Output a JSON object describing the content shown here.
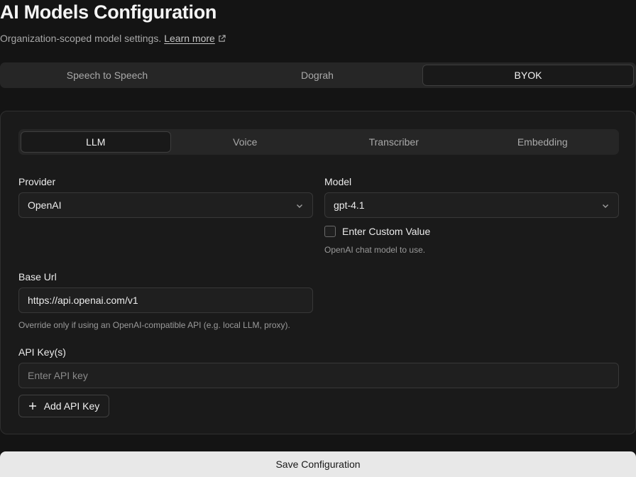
{
  "header": {
    "title": "AI Models Configuration",
    "subtitle": "Organization-scoped model settings.",
    "learn_more": "Learn more"
  },
  "top_tabs": [
    {
      "label": "Speech to Speech",
      "active": false
    },
    {
      "label": "Dograh",
      "active": false
    },
    {
      "label": "BYOK",
      "active": true
    }
  ],
  "inner_tabs": [
    {
      "label": "LLM",
      "active": true
    },
    {
      "label": "Voice",
      "active": false
    },
    {
      "label": "Transcriber",
      "active": false
    },
    {
      "label": "Embedding",
      "active": false
    }
  ],
  "form": {
    "provider_label": "Provider",
    "provider_value": "OpenAI",
    "model_label": "Model",
    "model_value": "gpt-4.1",
    "custom_value_label": "Enter Custom Value",
    "custom_value_checked": false,
    "model_help": "OpenAI chat model to use.",
    "base_url_label": "Base Url",
    "base_url_value": "https://api.openai.com/v1",
    "base_url_help": "Override only if using an OpenAI-compatible API (e.g. local LLM, proxy).",
    "api_keys_label": "API Key(s)",
    "api_key_placeholder": "Enter API key",
    "add_api_key": "Add API Key"
  },
  "save_label": "Save Configuration",
  "icons": {
    "external_link": "external-link-icon",
    "chevron": "chevron-down-icon",
    "plus": "plus-icon"
  }
}
